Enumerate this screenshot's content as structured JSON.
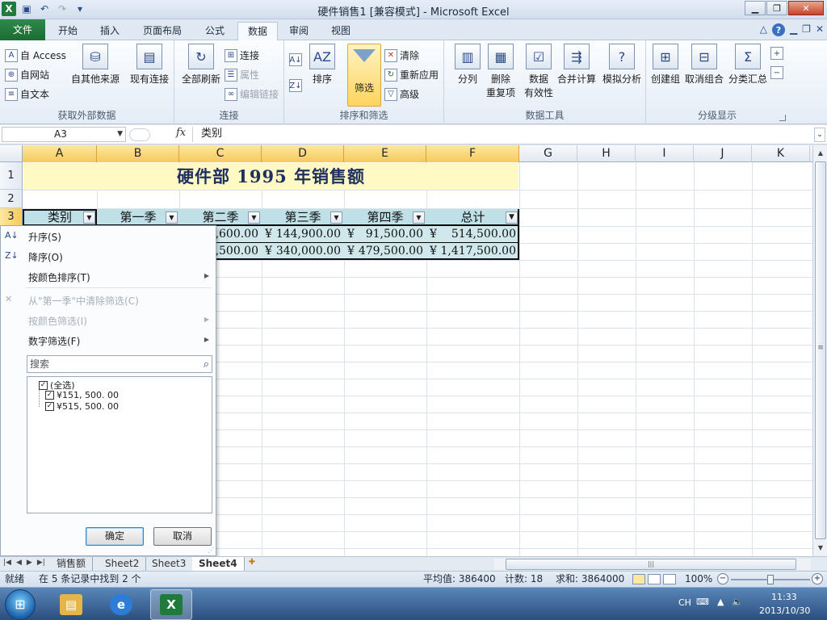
{
  "window": {
    "title": "硬件销售1  [兼容模式] - Microsoft Excel",
    "app_icon": "excel-icon",
    "qat": [
      "save-icon",
      "undo-icon",
      "redo-icon",
      "customize-qat-icon"
    ]
  },
  "ribbon_tabs": {
    "file": "文件",
    "items": [
      "开始",
      "插入",
      "页面布局",
      "公式",
      "数据",
      "审阅",
      "视图"
    ],
    "active": "数据"
  },
  "ribbon": {
    "get_external": {
      "access": "自 Access",
      "web": "自网站",
      "text": "自文本",
      "other": "自其他来源",
      "existing": "现有连接",
      "label": "获取外部数据"
    },
    "connections": {
      "refresh_all": "全部刷新",
      "connections": "连接",
      "properties": "属性",
      "edit_links": "编辑链接",
      "label": "连接"
    },
    "sort_filter": {
      "sort": "排序",
      "filter": "筛选",
      "clear": "清除",
      "reapply": "重新应用",
      "advanced": "高级",
      "label": "排序和筛选"
    },
    "data_tools": {
      "text_to_columns": "分列",
      "remove_dup_1": "删除",
      "remove_dup_2": "重复项",
      "validation_1": "数据",
      "validation_2": "有效性",
      "consolidate": "合并计算",
      "whatif": "模拟分析",
      "label": "数据工具"
    },
    "outline": {
      "group": "创建组",
      "ungroup": "取消组合",
      "subtotal": "分类汇总",
      "label": "分级显示"
    }
  },
  "formula_bar": {
    "name_box": "A3",
    "fx": "fx",
    "value": "类别"
  },
  "sheet": {
    "columns": [
      "A",
      "B",
      "C",
      "D",
      "E",
      "F",
      "G",
      "H",
      "I",
      "J",
      "K"
    ],
    "rows": [
      "1",
      "2",
      "3"
    ],
    "title": "硬件部  1995  年销售额",
    "headers": [
      "类别",
      "第一季",
      "第二季",
      "第三季",
      "第四季",
      "总计"
    ],
    "data_rows": [
      {
        "c": ",600.00",
        "d": "144,900.00",
        "e": "91,500.00",
        "f": "514,500.00"
      },
      {
        "c": ",500.00",
        "d": "340,000.00",
        "e": "479,500.00",
        "f": "1,417,500.00"
      }
    ],
    "currency": "¥"
  },
  "filter_dropdown": {
    "sort_asc": "升序(S)",
    "sort_desc": "降序(O)",
    "sort_by_color": "按颜色排序(T)",
    "clear_filter": "从\"第一季\"中清除筛选(C)",
    "filter_by_color": "按颜色筛选(I)",
    "number_filters": "数字筛选(F)",
    "search_placeholder": "搜索",
    "items": [
      "(全选)",
      "¥151, 500. 00",
      "¥515, 500. 00"
    ],
    "ok": "确定",
    "cancel": "取消"
  },
  "sheet_tabs": {
    "items": [
      "销售额",
      "Sheet2",
      "Sheet3",
      "Sheet4"
    ],
    "active": "Sheet4"
  },
  "status": {
    "ready": "就绪",
    "found": "在 5 条记录中找到 2 个",
    "average": "平均值: 386400",
    "count": "计数: 18",
    "sum": "求和: 3864000",
    "zoom": "100%"
  },
  "taskbar": {
    "apps": [
      "explorer-icon",
      "ie-icon",
      "excel-icon"
    ],
    "lang": "CH",
    "time": "11:33",
    "date": "2013/10/30"
  },
  "colors": {
    "accent": "#1b6b33",
    "title_fill": "#fff9c4",
    "header_fill": "#bfe0e6",
    "data_fill": "#d0e8ec"
  }
}
